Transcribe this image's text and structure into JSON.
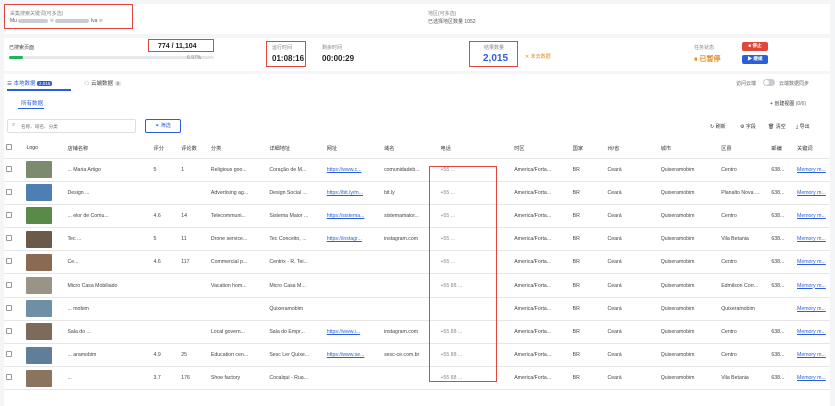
{
  "colors": {
    "accent": "#2b5fd9",
    "danger": "#e0463c",
    "orange": "#e08a1e",
    "progress": "#23b35d"
  },
  "keywords": {
    "label": "采集搜索关键词(可多选)",
    "tags": [
      "Mu",
      "Iva"
    ]
  },
  "region": {
    "label": "地区(可多选)",
    "count_text": "已选择地区数量 1052"
  },
  "progress": {
    "label": "已搜索页面",
    "value": "774 / 11,104",
    "percent": "6.97%",
    "fraction": 0.0697
  },
  "elapsed": {
    "label": "运行时间",
    "value": "01:08:16"
  },
  "remaining": {
    "label": "剩余时间",
    "value": "00:00:29"
  },
  "results": {
    "label": "结果数量",
    "value": "2,015",
    "note": "未去数据"
  },
  "task": {
    "label": "任务状态",
    "stop_label": "停止",
    "status": "已暂停",
    "continue_label": "继续"
  },
  "tabs": {
    "local_label": "本地数据",
    "local_count": "2,015",
    "cloud_label": "云端数据",
    "cloud_count": "0"
  },
  "toggle": {
    "label_left": "访问云端",
    "label_right": "云端数据同步"
  },
  "subtabs": {
    "all_label": "所有数据",
    "create_view": "创建视图",
    "view_count": "(0/6)"
  },
  "search": {
    "placeholder": "名称、域名、分类",
    "filter_label": "筛选"
  },
  "toolbar": {
    "refresh": "刷新",
    "fields": "字段",
    "dedupe": "清空",
    "export": "导出"
  },
  "table": {
    "headers": [
      "",
      "Logo",
      "店铺名称",
      "评分",
      "评论数",
      "分类",
      "详细地址",
      "网址",
      "域名",
      "电话",
      "时区",
      "国家",
      "州/省",
      "城市",
      "区县",
      "邮编",
      "关键词"
    ],
    "rows": [
      {
        "thumb": "#7c8a6e",
        "name": "... Maria Artigo",
        "rating": "5",
        "reviews": "1",
        "category": "Religious goo...",
        "address": "Coração de M...",
        "website": "https://www.c...",
        "domain": "comunidadeb...",
        "phone": "+55 ...",
        "tz": "America/Forta...",
        "country": "BR",
        "state": "Ceará",
        "city": "Quixeramobim",
        "district": "Centro",
        "zip": "638...",
        "keyword": "Memory m..."
      },
      {
        "thumb": "#4e7fb4",
        "name": "Design ...",
        "rating": "",
        "reviews": "",
        "category": "Advertising ag...",
        "address": "Design Social ...",
        "website": "https://bit.ly/m...",
        "domain": "bit.ly",
        "phone": "+55 ...",
        "tz": "America/Forta...",
        "country": "BR",
        "state": "Ceará",
        "city": "Quixeramobim",
        "district": "Planalto Nova ...",
        "zip": "638...",
        "keyword": "Memory m..."
      },
      {
        "thumb": "#5a8a4a",
        "name": "... elor de Comu...",
        "rating": "4.6",
        "reviews": "14",
        "category": "Telecommuni...",
        "address": "Sistema Maior ...",
        "website": "https://sistema...",
        "domain": "sistemamaior...",
        "phone": "+55 ...",
        "tz": "America/Forta...",
        "country": "BR",
        "state": "Ceará",
        "city": "Quixeramobim",
        "district": "Centro",
        "zip": "638...",
        "keyword": "Memory m..."
      },
      {
        "thumb": "#6b5a4a",
        "name": "Tec ...",
        "rating": "5",
        "reviews": "11",
        "category": "Drone service...",
        "address": "Tec Conceito, ...",
        "website": "https://instagr...",
        "domain": "instagram.com",
        "phone": "+55 ...",
        "tz": "America/Forta...",
        "country": "BR",
        "state": "Ceará",
        "city": "Quixeramobim",
        "district": "Vila Betania",
        "zip": "638...",
        "keyword": "Memory m..."
      },
      {
        "thumb": "#8a6a52",
        "name": "Ce...",
        "rating": "4.6",
        "reviews": "117",
        "category": "Commercial p...",
        "address": "Centrix - R. Tei...",
        "website": "",
        "domain": "",
        "phone": "+55 ...",
        "tz": "America/Forta...",
        "country": "BR",
        "state": "Ceará",
        "city": "Quixeramobim",
        "district": "Centro",
        "zip": "638...",
        "keyword": "Memory m..."
      },
      {
        "thumb": "#9a9388",
        "name": "Micro Casa Mobiliado",
        "rating": "",
        "reviews": "",
        "category": "Vacation hom...",
        "address": "Micro Casa M...",
        "website": "",
        "domain": "",
        "phone": "+55 88 ...",
        "tz": "America/Forta...",
        "country": "BR",
        "state": "Ceará",
        "city": "Quixeramobim",
        "district": "Edmilson Corr...",
        "zip": "638...",
        "keyword": "Memory m..."
      },
      {
        "thumb": "#6f8fa6",
        "name": "... mobim",
        "rating": "",
        "reviews": "",
        "category": "",
        "address": "Quixeramobim",
        "website": "",
        "domain": "",
        "phone": "",
        "tz": "America/Forta...",
        "country": "BR",
        "state": "Ceará",
        "city": "Quixeramobim",
        "district": "Quixeramobim",
        "zip": "",
        "keyword": "Memory m..."
      },
      {
        "thumb": "#7e6a58",
        "name": "Sala do ...",
        "rating": "",
        "reviews": "",
        "category": "Local govern...",
        "address": "Sala do Empr...",
        "website": "https://www.i...",
        "domain": "instagram.com",
        "phone": "+55 88 ...",
        "tz": "America/Forta...",
        "country": "BR",
        "state": "Ceará",
        "city": "Quixeramobim",
        "district": "Centro",
        "zip": "638...",
        "keyword": "Memory m..."
      },
      {
        "thumb": "#5e7e9a",
        "name": "... aramobim",
        "rating": "4.9",
        "reviews": "25",
        "category": "Education cen...",
        "address": "Sesc Ler Quixe...",
        "website": "https://www.se...",
        "domain": "sesc-ce.com.br",
        "phone": "+55 88 ...",
        "tz": "America/Forta...",
        "country": "BR",
        "state": "Ceará",
        "city": "Quixeramobim",
        "district": "Centro",
        "zip": "638...",
        "keyword": "Memory m..."
      },
      {
        "thumb": "#8a7460",
        "name": "...",
        "rating": "3.7",
        "reviews": "176",
        "category": "Shoe factory",
        "address": "Cocalqui - Rua...",
        "website": "",
        "domain": "",
        "phone": "+55 88 ...",
        "tz": "America/Forta...",
        "country": "BR",
        "state": "Ceará",
        "city": "Quixeramobim",
        "district": "Vila Betania",
        "zip": "638...",
        "keyword": "Memory m..."
      }
    ]
  }
}
